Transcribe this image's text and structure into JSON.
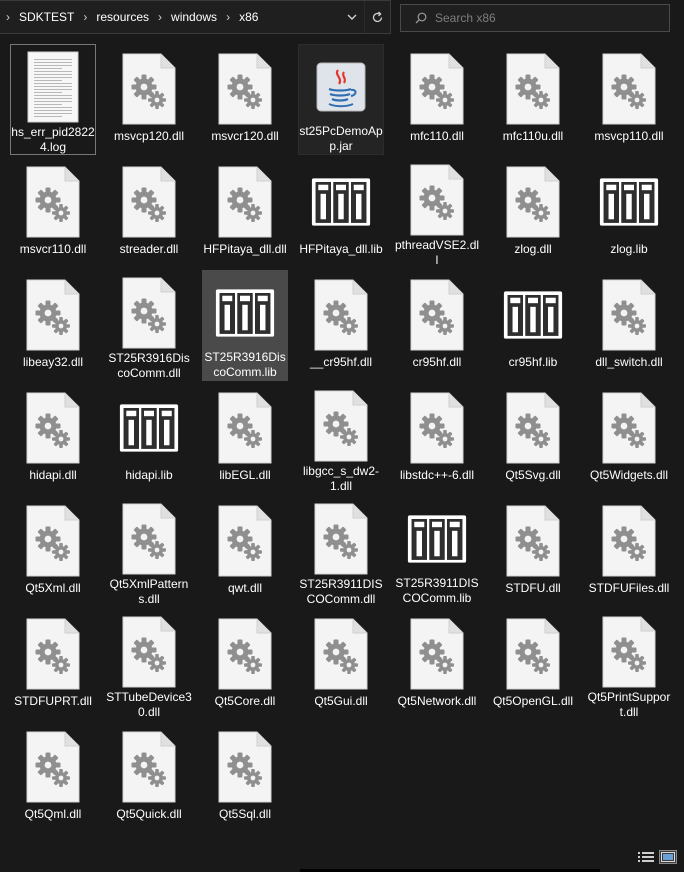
{
  "breadcrumb": [
    "SDKTEST",
    "resources",
    "windows",
    "x86"
  ],
  "search": {
    "placeholder": "Search x86",
    "value": ""
  },
  "files": [
    {
      "name": "hs_err_pid28224.log",
      "icon": "text-file-icon",
      "state": "outlined"
    },
    {
      "name": "msvcp120.dll",
      "icon": "dll-gear-icon"
    },
    {
      "name": "msvcr120.dll",
      "icon": "dll-gear-icon"
    },
    {
      "name": "st25PcDemoApp.jar",
      "icon": "java-icon",
      "state": "framed"
    },
    {
      "name": "mfc110.dll",
      "icon": "dll-gear-icon"
    },
    {
      "name": "mfc110u.dll",
      "icon": "dll-gear-icon"
    },
    {
      "name": "msvcp110.dll",
      "icon": "dll-gear-icon"
    },
    {
      "name": "msvcr110.dll",
      "icon": "dll-gear-icon"
    },
    {
      "name": "streader.dll",
      "icon": "dll-gear-icon"
    },
    {
      "name": "HFPitaya_dll.dll",
      "icon": "dll-gear-icon"
    },
    {
      "name": "HFPitaya_dll.lib",
      "icon": "lib-binders-icon"
    },
    {
      "name": "pthreadVSE2.dll",
      "icon": "dll-gear-icon"
    },
    {
      "name": "zlog.dll",
      "icon": "dll-gear-icon"
    },
    {
      "name": "zlog.lib",
      "icon": "lib-binders-icon"
    },
    {
      "name": "libeay32.dll",
      "icon": "dll-gear-icon"
    },
    {
      "name": "ST25R3916DiscoComm.dll",
      "icon": "dll-gear-icon"
    },
    {
      "name": "ST25R3916DiscoComm.lib",
      "icon": "lib-binders-icon",
      "state": "selected"
    },
    {
      "name": "__cr95hf.dll",
      "icon": "dll-gear-icon"
    },
    {
      "name": "cr95hf.dll",
      "icon": "dll-gear-icon"
    },
    {
      "name": "cr95hf.lib",
      "icon": "lib-binders-icon"
    },
    {
      "name": "dll_switch.dll",
      "icon": "dll-gear-icon"
    },
    {
      "name": "hidapi.dll",
      "icon": "dll-gear-icon"
    },
    {
      "name": "hidapi.lib",
      "icon": "lib-binders-icon"
    },
    {
      "name": "libEGL.dll",
      "icon": "dll-gear-icon"
    },
    {
      "name": "libgcc_s_dw2-1.dll",
      "icon": "dll-gear-icon"
    },
    {
      "name": "libstdc++-6.dll",
      "icon": "dll-gear-icon"
    },
    {
      "name": "Qt5Svg.dll",
      "icon": "dll-gear-icon"
    },
    {
      "name": "Qt5Widgets.dll",
      "icon": "dll-gear-icon"
    },
    {
      "name": "Qt5Xml.dll",
      "icon": "dll-gear-icon"
    },
    {
      "name": "Qt5XmlPatterns.dll",
      "icon": "dll-gear-icon"
    },
    {
      "name": "qwt.dll",
      "icon": "dll-gear-icon"
    },
    {
      "name": "ST25R3911DISCOComm.dll",
      "icon": "dll-gear-icon"
    },
    {
      "name": "ST25R3911DISCOComm.lib",
      "icon": "lib-binders-icon"
    },
    {
      "name": "STDFU.dll",
      "icon": "dll-gear-icon"
    },
    {
      "name": "STDFUFiles.dll",
      "icon": "dll-gear-icon"
    },
    {
      "name": "STDFUPRT.dll",
      "icon": "dll-gear-icon"
    },
    {
      "name": "STTubeDevice30.dll",
      "icon": "dll-gear-icon"
    },
    {
      "name": "Qt5Core.dll",
      "icon": "dll-gear-icon"
    },
    {
      "name": "Qt5Gui.dll",
      "icon": "dll-gear-icon"
    },
    {
      "name": "Qt5Network.dll",
      "icon": "dll-gear-icon"
    },
    {
      "name": "Qt5OpenGL.dll",
      "icon": "dll-gear-icon"
    },
    {
      "name": "Qt5PrintSupport.dll",
      "icon": "dll-gear-icon"
    },
    {
      "name": "Qt5Qml.dll",
      "icon": "dll-gear-icon"
    },
    {
      "name": "Qt5Quick.dll",
      "icon": "dll-gear-icon"
    },
    {
      "name": "Qt5Sql.dll",
      "icon": "dll-gear-icon"
    }
  ],
  "colors": {
    "background": "#191919",
    "selected_bg": "#4a4a4a",
    "java_red": "#e2382c",
    "java_blue": "#2f6db5"
  },
  "status_icons": [
    "details-view-icon",
    "large-icons-view-icon"
  ]
}
